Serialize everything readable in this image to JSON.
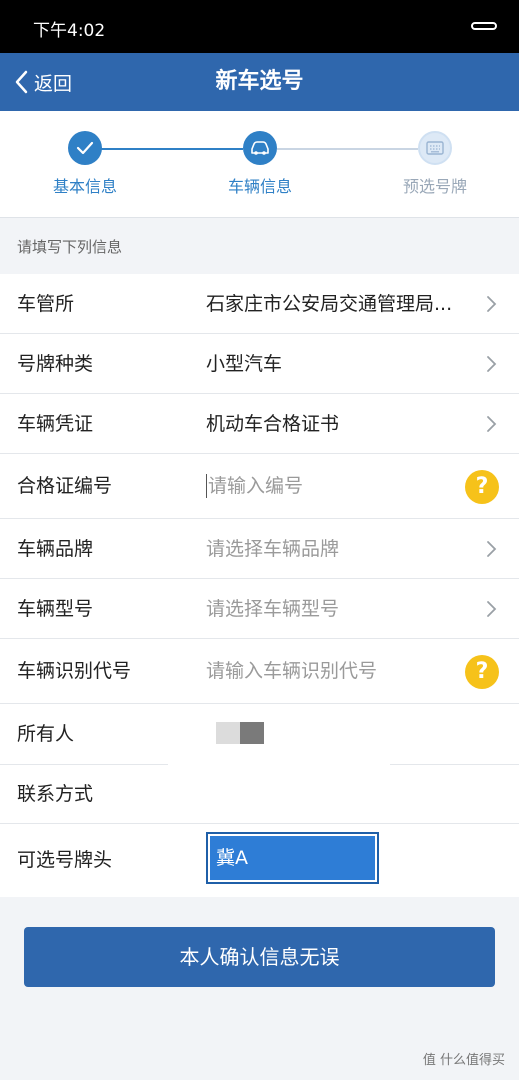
{
  "statusbar": {
    "time": "下午4:02"
  },
  "navbar": {
    "back_label": "返回",
    "title": "新车选号"
  },
  "steps": [
    {
      "label": "基本信息",
      "state": "done"
    },
    {
      "label": "车辆信息",
      "state": "active"
    },
    {
      "label": "预选号牌",
      "state": "pending"
    }
  ],
  "hint": "请填写下列信息",
  "form": {
    "office": {
      "label": "车管所",
      "value": "石家庄市公安局交通管理局..."
    },
    "plate_type": {
      "label": "号牌种类",
      "value": "小型汽车"
    },
    "certificate": {
      "label": "车辆凭证",
      "value": "机动车合格证书"
    },
    "cert_no": {
      "label": "合格证编号",
      "placeholder": "请输入编号"
    },
    "brand": {
      "label": "车辆品牌",
      "placeholder": "请选择车辆品牌"
    },
    "model": {
      "label": "车辆型号",
      "placeholder": "请选择车辆型号"
    },
    "vin": {
      "label": "车辆识别代号",
      "placeholder": "请输入车辆识别代号"
    },
    "owner": {
      "label": "所有人"
    },
    "contact": {
      "label": "联系方式"
    },
    "plate_prefix": {
      "label": "可选号牌头",
      "value": "冀A"
    }
  },
  "confirm_label": "本人确认信息无误",
  "watermark": "值 什么值得买",
  "colors": {
    "primary": "#2f67ad",
    "step_active": "#2f80c6",
    "help_icon": "#f6c21a"
  },
  "icons": {
    "back": "chevron-left-icon",
    "step_done": "check-icon",
    "step_active": "car-icon",
    "step_pending": "keyboard-icon",
    "row_arrow": "chevron-right-icon",
    "help": "question-icon"
  }
}
